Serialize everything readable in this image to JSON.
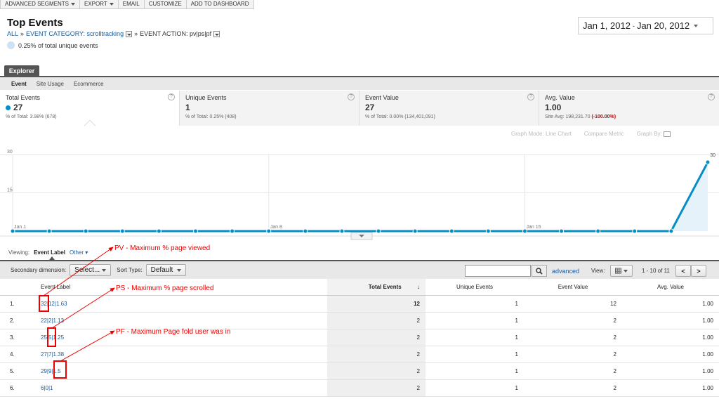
{
  "toolbar": {
    "items": [
      "ADVANCED SEGMENTS",
      "EXPORT",
      "EMAIL",
      "CUSTOMIZE",
      "ADD TO DASHBOARD"
    ]
  },
  "header": {
    "title": "Top Events",
    "breadcrumb_all": "ALL",
    "breadcrumb_sep": "»",
    "breadcrumb_category": "EVENT CATEGORY: scrolltracking",
    "breadcrumb_action": "EVENT ACTION: pv|ps|pf",
    "percent_of_total": "0.25% of total unique events",
    "date_start": "Jan 1, 2012",
    "date_sep": "-",
    "date_end": "Jan 20, 2012"
  },
  "tabs": {
    "explorer": "Explorer",
    "subtabs": [
      "Event",
      "Site Usage",
      "Ecommerce"
    ]
  },
  "scorecards": [
    {
      "label": "Total Events",
      "value": "27",
      "sub": "% of Total: 3.98% (678)"
    },
    {
      "label": "Unique Events",
      "value": "1",
      "sub": "% of Total: 0.25% (408)"
    },
    {
      "label": "Event Value",
      "value": "27",
      "sub": "% of Total: 0.00% (134,401,091)"
    },
    {
      "label": "Avg. Value",
      "value": "1.00",
      "sub_prefix": "Site Avg: 198,231.70",
      "sub_delta": "(-100.00%)"
    }
  ],
  "graph_options": {
    "mode_label": "Graph Mode:",
    "mode_value": "Line Chart",
    "compare": "Compare Metric",
    "graph_by": "Graph By:"
  },
  "chart_data": {
    "type": "line",
    "x": [
      "Jan 1",
      "Jan 2",
      "Jan 3",
      "Jan 4",
      "Jan 5",
      "Jan 6",
      "Jan 7",
      "Jan 8",
      "Jan 9",
      "Jan 10",
      "Jan 11",
      "Jan 12",
      "Jan 13",
      "Jan 14",
      "Jan 15",
      "Jan 16",
      "Jan 17",
      "Jan 18",
      "Jan 19",
      "Jan 20"
    ],
    "series": [
      {
        "values": [
          0,
          0,
          0,
          0,
          0,
          0,
          0,
          0,
          0,
          0,
          0,
          0,
          0,
          0,
          0,
          0,
          0,
          0,
          0,
          27
        ]
      }
    ],
    "ylim": [
      0,
      30
    ],
    "yticks": [
      "30",
      "15"
    ],
    "xtick_labels": [
      "Jan 1",
      "Jan 8",
      "Jan 15"
    ],
    "end_label": "30",
    "color": "#058dc7",
    "fill": "#e6f2fa"
  },
  "viewing": {
    "label": "Viewing:",
    "dimension": "Event Label",
    "other": "Other"
  },
  "controls": {
    "secondary_label": "Secondary dimension:",
    "secondary_value": "Select...",
    "sort_label": "Sort Type:",
    "sort_value": "Default",
    "advanced": "advanced",
    "view_label": "View:",
    "paging": "1 - 10 of 11",
    "prev": "<",
    "next": ">"
  },
  "table": {
    "headers": [
      "Event Label",
      "Total Events",
      "Unique Events",
      "Event Value",
      "Avg. Value"
    ],
    "rows": [
      {
        "idx": "1.",
        "label": "32|12|1.63",
        "total": "12",
        "unique": "1",
        "value": "12",
        "avg": "1.00"
      },
      {
        "idx": "2.",
        "label": "22|2|1.13",
        "total": "2",
        "unique": "1",
        "value": "2",
        "avg": "1.00"
      },
      {
        "idx": "3.",
        "label": "25|5|1.25",
        "total": "2",
        "unique": "1",
        "value": "2",
        "avg": "1.00"
      },
      {
        "idx": "4.",
        "label": "27|7|1.38",
        "total": "2",
        "unique": "1",
        "value": "2",
        "avg": "1.00"
      },
      {
        "idx": "5.",
        "label": "29|9|1.5",
        "total": "2",
        "unique": "1",
        "value": "2",
        "avg": "1.00"
      },
      {
        "idx": "6.",
        "label": "6|0|1",
        "total": "2",
        "unique": "1",
        "value": "2",
        "avg": "1.00"
      }
    ]
  },
  "annotations": {
    "pv": "PV - Maximum % page viewed",
    "ps": "PS - Maximum % page scrolled",
    "pf": "PF - Maximum Page fold user was in",
    "color": "#ee0000"
  }
}
